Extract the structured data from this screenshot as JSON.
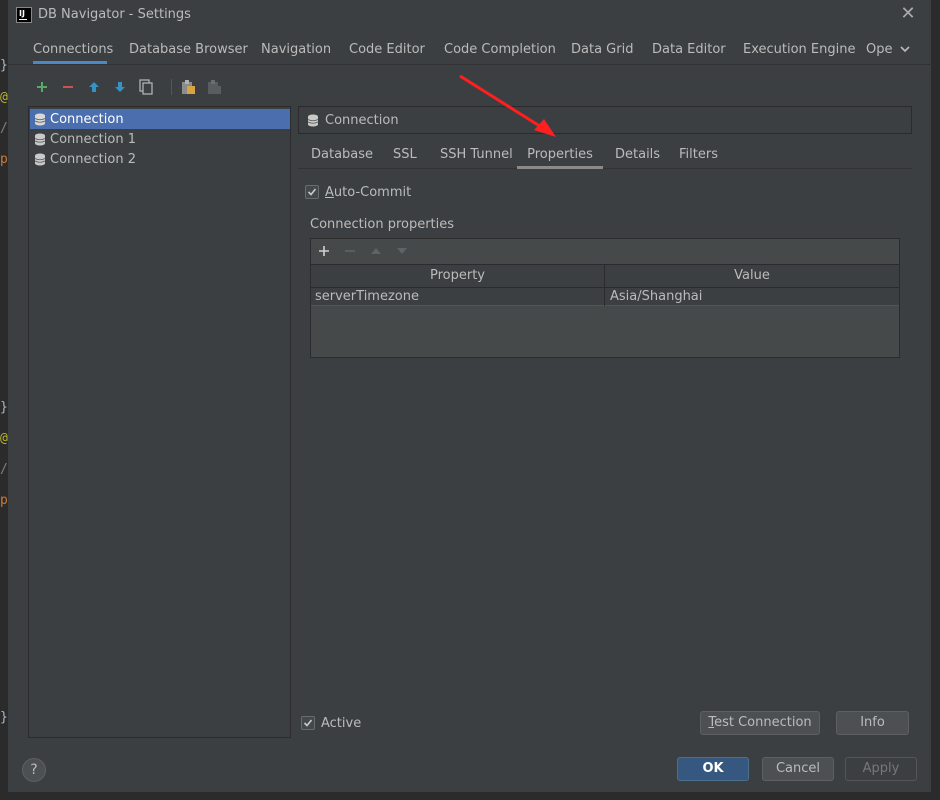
{
  "window": {
    "title": "DB Navigator - Settings",
    "app_icon_text": "IJ"
  },
  "main_tabs": [
    {
      "label": "Connections",
      "selected": true
    },
    {
      "label": "Database Browser"
    },
    {
      "label": "Navigation"
    },
    {
      "label": "Code Editor"
    },
    {
      "label": "Code Completion"
    },
    {
      "label": "Data Grid"
    },
    {
      "label": "Data Editor"
    },
    {
      "label": "Execution Engine"
    },
    {
      "label": "Ope"
    }
  ],
  "connections": [
    {
      "label": "Connection",
      "selected": true
    },
    {
      "label": "Connection 1"
    },
    {
      "label": "Connection 2"
    }
  ],
  "detail": {
    "header": "Connection",
    "sub_tabs": [
      {
        "label": "Database"
      },
      {
        "label": "SSL"
      },
      {
        "label": "SSH Tunnel"
      },
      {
        "label": "Properties",
        "selected": true
      },
      {
        "label": "Details"
      },
      {
        "label": "Filters"
      }
    ],
    "auto_commit": {
      "label_underlined": "A",
      "label_rest": "uto-Commit",
      "checked": true
    },
    "connection_properties_label": "Connection properties",
    "table": {
      "columns": [
        "Property",
        "Value"
      ],
      "rows": [
        {
          "property": "serverTimezone",
          "value": "Asia/Shanghai"
        }
      ]
    }
  },
  "bottom": {
    "active": {
      "label": "Active",
      "checked": true
    },
    "test_connection": {
      "underlined": "T",
      "rest": "est Connection"
    },
    "info": "Info",
    "ok": "OK",
    "cancel": "Cancel",
    "apply": "Apply",
    "help": "?"
  },
  "editor_gutter": [
    {
      "char": "}",
      "color": "#a9b7c6"
    },
    {
      "char": "@",
      "color": "#bbb529"
    },
    {
      "char": "/",
      "color": "#808080"
    },
    {
      "char": "p",
      "color": "#cc7832"
    },
    {
      "char": "}",
      "color": "#a9b7c6"
    },
    {
      "char": "@",
      "color": "#bbb529"
    },
    {
      "char": "/",
      "color": "#808080"
    },
    {
      "char": "p",
      "color": "#cc7832"
    },
    {
      "char": "}",
      "color": "#a9b7c6"
    }
  ],
  "colors": {
    "dialog_bg": "#3c3f41",
    "selection": "#4b6eaf",
    "tab_underline": "#4a88c7",
    "add_green": "#59a869",
    "remove_red": "#c75450",
    "move_blue": "#3592c4",
    "annotation_arrow": "#ff1f1f"
  }
}
